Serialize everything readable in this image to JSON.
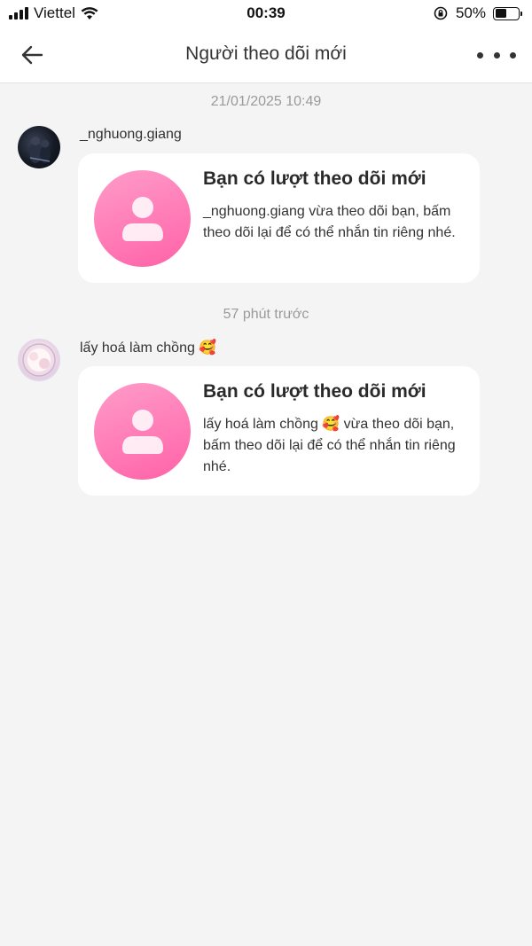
{
  "status_bar": {
    "carrier": "Viettel",
    "time": "00:39",
    "battery_percent": "50%",
    "battery_level": 0.5
  },
  "nav": {
    "title": "Người theo dõi mới"
  },
  "notifications": [
    {
      "timestamp": "21/01/2025 10:49",
      "sender": "_nghuong.giang",
      "card_title": "Bạn có lượt theo dõi mới",
      "card_body": "_nghuong.giang vừa theo dõi bạn, bấm theo dõi lại để có thể nhắn tin riêng nhé."
    },
    {
      "timestamp": "57 phút trước",
      "sender": "lấy hoá làm chồng 🥰",
      "card_title": "Bạn có lượt theo dõi mới",
      "card_body": "lấy hoá làm chồng 🥰 vừa theo dõi bạn, bấm theo dõi lại để có thể nhắn tin riêng nhé."
    }
  ],
  "colors": {
    "accent_pink_light": "#ff9cc9",
    "accent_pink_dark": "#ff62a8",
    "background": "#f4f4f5"
  }
}
